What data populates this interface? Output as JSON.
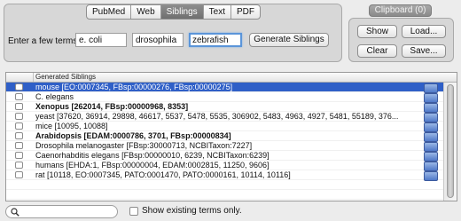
{
  "tabs": [
    {
      "label": "PubMed",
      "active": false
    },
    {
      "label": "Web",
      "active": false
    },
    {
      "label": "Siblings",
      "active": true
    },
    {
      "label": "Text",
      "active": false
    },
    {
      "label": "PDF",
      "active": false
    }
  ],
  "terms_label": "Enter a few terms:",
  "terms": [
    "e. coli",
    "drosophila",
    "zebrafish"
  ],
  "generate_button": "Generate Siblings",
  "clipboard": {
    "title": "Clipboard (0)",
    "show": "Show",
    "load": "Load...",
    "clear": "Clear",
    "save": "Save..."
  },
  "table": {
    "header": "Generated Siblings",
    "rows": [
      {
        "text": "mouse  [EO:0007345, FBsp:00000276, FBsp:00000275]",
        "bold": false,
        "selected": true
      },
      {
        "text": "C. elegans",
        "bold": false,
        "selected": false
      },
      {
        "text": "Xenopus  [262014, FBsp:00000968, 8353]",
        "bold": true,
        "selected": false
      },
      {
        "text": "yeast  [37620, 36914, 29898, 46617, 5537, 5478, 5535, 306902, 5483, 4963, 4927, 5481, 55189, 376...",
        "bold": false,
        "selected": false
      },
      {
        "text": "mice  [10095, 10088]",
        "bold": false,
        "selected": false
      },
      {
        "text": "Arabidopsis  [EDAM:0000786, 3701, FBsp:00000834]",
        "bold": true,
        "selected": false
      },
      {
        "text": "Drosophila melanogaster  [FBsp:30000713, NCBITaxon:7227]",
        "bold": false,
        "selected": false
      },
      {
        "text": "Caenorhabditis elegans  [FBsp:00000010, 6239, NCBITaxon:6239]",
        "bold": false,
        "selected": false
      },
      {
        "text": "humans  [EHDA:1, FBsp:00000004, EDAM:0002815, 11250, 9606]",
        "bold": false,
        "selected": false
      },
      {
        "text": "rat  [10118, EO:0007345, PATO:0001470, PATO:0000161, 10114, 10116]",
        "bold": false,
        "selected": false
      },
      {
        "text": "",
        "bold": false,
        "selected": false
      },
      {
        "text": "",
        "bold": false,
        "selected": false
      }
    ]
  },
  "search": {
    "value": ""
  },
  "show_existing": "Show existing terms only.",
  "colors": {
    "selection": "#2f5fc7",
    "panel": "#d7d7d7",
    "background": "#ececec",
    "focus": "#5b95d9"
  }
}
